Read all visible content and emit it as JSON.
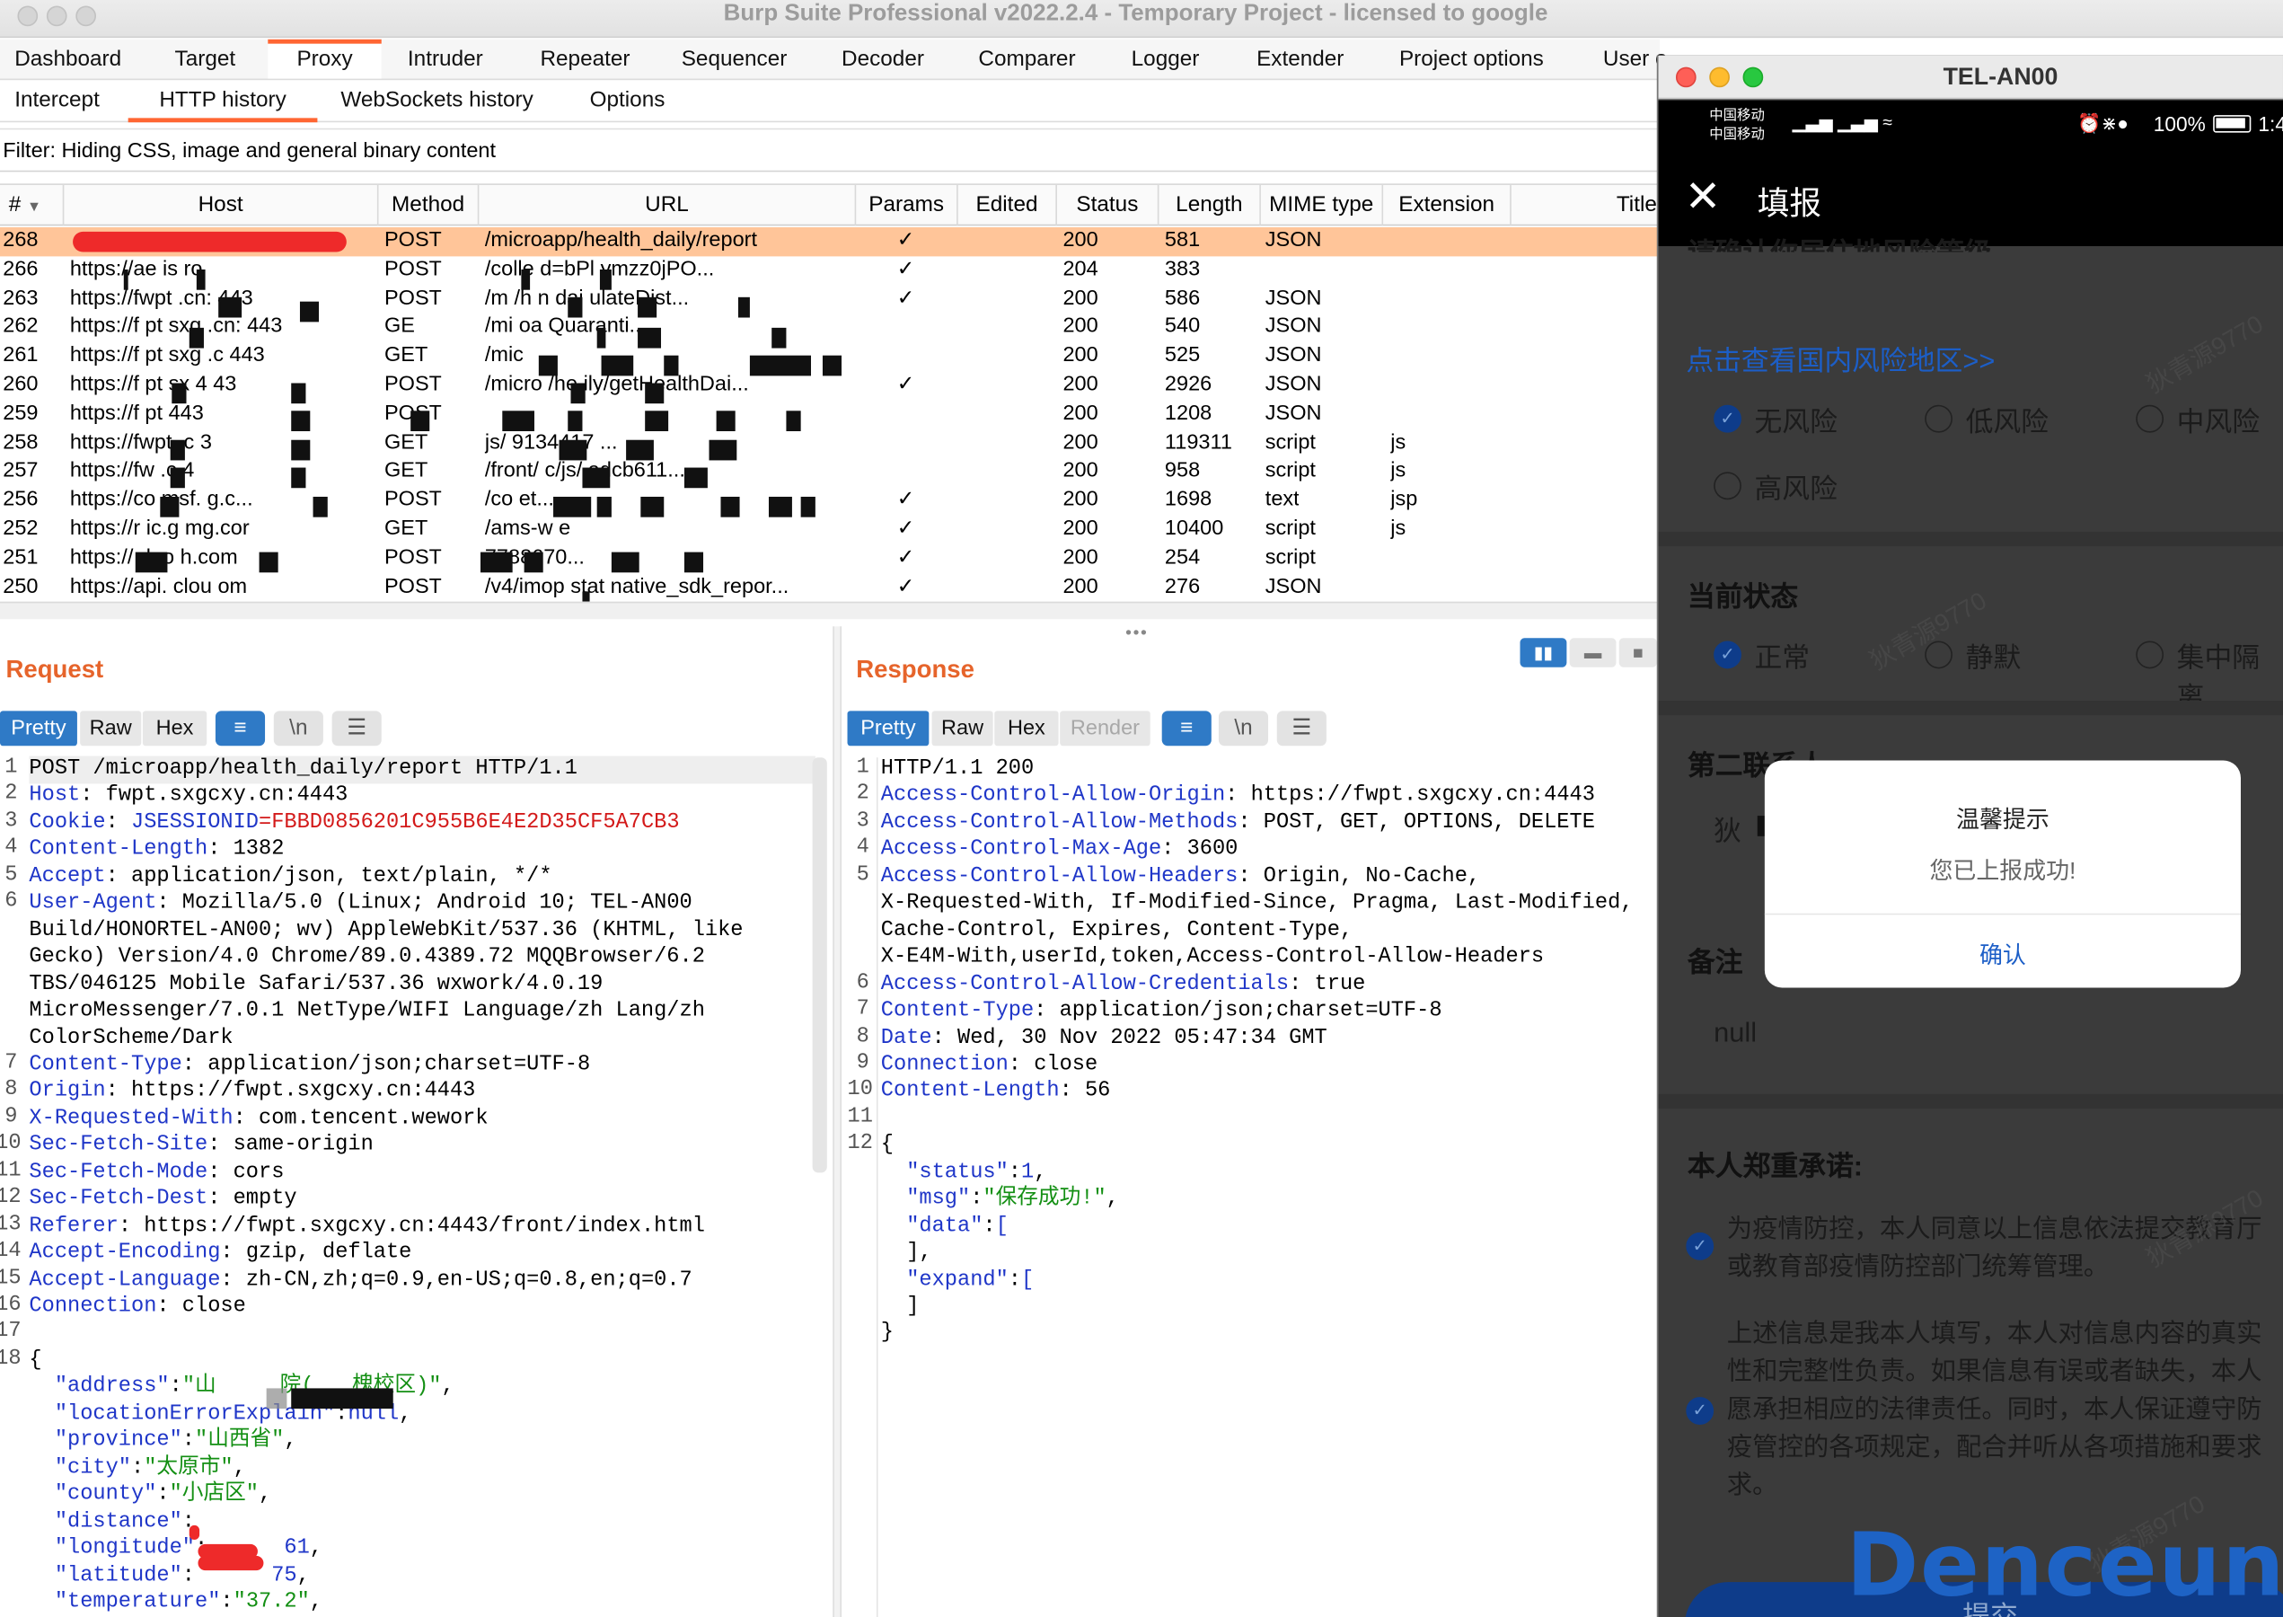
{
  "window": {
    "title": "Burp Suite Professional v2022.2.4 - Temporary Project - licensed to google"
  },
  "main_tabs": [
    "Dashboard",
    "Target",
    "Proxy",
    "Intruder",
    "Repeater",
    "Sequencer",
    "Decoder",
    "Comparer",
    "Logger",
    "Extender",
    "Project options",
    "User o"
  ],
  "proxy_tabs": [
    "Intercept",
    "HTTP history",
    "WebSockets history",
    "Options"
  ],
  "filter": "Filter: Hiding CSS, image and general binary content",
  "columns": [
    "#",
    "Host",
    "Method",
    "URL",
    "Params",
    "Edited",
    "Status",
    "Length",
    "MIME type",
    "Extension",
    "Title"
  ],
  "rows": [
    {
      "num": "268",
      "host": "",
      "method": "POST",
      "url": "/microapp/health_daily/report",
      "params": "✓",
      "status": "200",
      "length": "581",
      "mime": "JSON",
      "ext": ""
    },
    {
      "num": "266",
      "host": "https://ae  is  ro",
      "method": "POST",
      "url": "/colle     d=bPl           ymzz0jPO...",
      "params": "✓",
      "status": "204",
      "length": "383",
      "mime": "",
      "ext": ""
    },
    {
      "num": "263",
      "host": "https://fwpt        .cn:  443",
      "method": "POST",
      "url": "/m          /h     n dai    ulateDist...",
      "params": "✓",
      "status": "200",
      "length": "586",
      "mime": "JSON",
      "ext": ""
    },
    {
      "num": "262",
      "host": "https://f  pt  sxg    .cn:  443",
      "method": "GE",
      "url": "/mi  oa            Quaranti...",
      "params": "",
      "status": "200",
      "length": "540",
      "mime": "JSON",
      "ext": ""
    },
    {
      "num": "261",
      "host": "https://f  pt  sxg     .c   443",
      "method": "GET",
      "url": "/mic",
      "params": "",
      "status": "200",
      "length": "525",
      "mime": "JSON",
      "ext": ""
    },
    {
      "num": "260",
      "host": "https://f  pt  sx       4  43",
      "method": "POST",
      "url": "/micro     /he      ily/getHealthDai...",
      "params": "✓",
      "status": "200",
      "length": "2926",
      "mime": "JSON",
      "ext": ""
    },
    {
      "num": "259",
      "host": "https://f  pt       443",
      "method": "POST",
      "url": "",
      "params": "",
      "status": "200",
      "length": "1208",
      "mime": "JSON",
      "ext": ""
    },
    {
      "num": "258",
      "host": "https://fwpt    .c     3",
      "method": "GET",
      "url": "              js/            9134417 ...",
      "params": "",
      "status": "200",
      "length": "119311",
      "mime": "script",
      "ext": "js"
    },
    {
      "num": "257",
      "host": "https://fw       .c    4",
      "method": "GET",
      "url": "/front/   c/js/         adcb611...",
      "params": "",
      "status": "200",
      "length": "958",
      "mime": "script",
      "ext": "js"
    },
    {
      "num": "256",
      "host": "https://co     msf.   g.c...",
      "method": "POST",
      "url": "/co                          et...",
      "params": "✓",
      "status": "200",
      "length": "1698",
      "mime": "text",
      "ext": "jsp"
    },
    {
      "num": "252",
      "host": "https://r    ic.g    mg.cor",
      "method": "GET",
      "url": "/ams-w       e",
      "params": "✓",
      "status": "200",
      "length": "10400",
      "mime": "script",
      "ext": "js"
    },
    {
      "num": "251",
      "host": "https://      deo    h.com",
      "method": "POST",
      "url": "                        7788670...",
      "params": "✓",
      "status": "200",
      "length": "254",
      "mime": "script",
      "ext": ""
    },
    {
      "num": "250",
      "host": "https://api.      clou   om",
      "method": "POST",
      "url": "/v4/imop    stat   native_sdk_repor...",
      "params": "✓",
      "status": "200",
      "length": "276",
      "mime": "JSON",
      "ext": ""
    }
  ],
  "request": {
    "title": "Request",
    "buttons": [
      "Pretty",
      "Raw",
      "Hex"
    ],
    "icon_newline": "\\n",
    "lines": [
      {
        "n": "1",
        "t": "POST /microapp/health_daily/report HTTP/1.1"
      },
      {
        "n": "2",
        "k": "Host",
        "v": " fwpt.sxgcxy.cn:4443"
      },
      {
        "n": "3",
        "k": "Cookie",
        "v": " ",
        "ck": "JSESSIONID",
        "cv": "=FBBD0856201C955B6E4E2D35CF5A7CB3"
      },
      {
        "n": "4",
        "k": "Content-Length",
        "v": " 1382"
      },
      {
        "n": "5",
        "k": "Accept",
        "v": " application/json, text/plain, */*"
      },
      {
        "n": "6",
        "k": "User-Agent",
        "v": " Mozilla/5.0 (Linux; Android 10; TEL-AN00"
      },
      {
        "n": "",
        "t": "Build/HONORTEL-AN00; wv) AppleWebKit/537.36 (KHTML, like"
      },
      {
        "n": "",
        "t": "Gecko) Version/4.0 Chrome/89.0.4389.72 MQQBrowser/6.2"
      },
      {
        "n": "",
        "t": "TBS/046125 Mobile Safari/537.36 wxwork/4.0.19"
      },
      {
        "n": "",
        "t": "MicroMessenger/7.0.1 NetType/WIFI Language/zh Lang/zh"
      },
      {
        "n": "",
        "t": "ColorScheme/Dark"
      },
      {
        "n": "7",
        "k": "Content-Type",
        "v": " application/json;charset=UTF-8"
      },
      {
        "n": "8",
        "k": "Origin",
        "v": " https://fwpt.sxgcxy.cn:4443"
      },
      {
        "n": "9",
        "k": "X-Requested-With",
        "v": " com.tencent.wework"
      },
      {
        "n": "10",
        "k": "Sec-Fetch-Site",
        "v": " same-origin"
      },
      {
        "n": "11",
        "k": "Sec-Fetch-Mode",
        "v": " cors"
      },
      {
        "n": "12",
        "k": "Sec-Fetch-Dest",
        "v": " empty"
      },
      {
        "n": "13",
        "k": "Referer",
        "v": " https://fwpt.sxgcxy.cn:4443/front/index.html"
      },
      {
        "n": "14",
        "k": "Accept-Encoding",
        "v": " gzip, deflate"
      },
      {
        "n": "15",
        "k": "Accept-Language",
        "v": " zh-CN,zh;q=0.9,en-US;q=0.8,en;q=0.7"
      },
      {
        "n": "16",
        "k": "Connection",
        "v": " close"
      },
      {
        "n": "17",
        "t": ""
      },
      {
        "n": "18",
        "t": "{"
      },
      {
        "n": "",
        "jk": "  \"address\"",
        "jv": "\"山     院(   槐校区)\"",
        "tail": ","
      },
      {
        "n": "",
        "jk": "  \"locationErrorExplain\"",
        "jn": "null",
        "tail": ","
      },
      {
        "n": "",
        "jk": "  \"province\"",
        "jv": "\"山西省\"",
        "tail": ","
      },
      {
        "n": "",
        "jk": "  \"city\"",
        "jv": "\"太原市\"",
        "tail": ","
      },
      {
        "n": "",
        "jk": "  \"county\"",
        "jv": "\"小店区\"",
        "tail": ","
      },
      {
        "n": "",
        "jk": "  \"distance\"",
        "jn": "",
        "tail": ""
      },
      {
        "n": "",
        "jk": "  \"longitude\"",
        "jn": "      61",
        "tail": ","
      },
      {
        "n": "",
        "jk": "  \"latitude\"",
        "jn": "      75",
        "tail": ","
      },
      {
        "n": "",
        "jk": "  \"temperature\"",
        "jv": "\"37.2\"",
        "tail": ","
      }
    ]
  },
  "response": {
    "title": "Response",
    "buttons": [
      "Pretty",
      "Raw",
      "Hex",
      "Render"
    ],
    "icon_newline": "\\n",
    "lines": [
      {
        "n": "1",
        "t": "HTTP/1.1 200"
      },
      {
        "n": "2",
        "k": "Access-Control-Allow-Origin",
        "v": " https://fwpt.sxgcxy.cn:4443"
      },
      {
        "n": "3",
        "k": "Access-Control-Allow-Methods",
        "v": " POST, GET, OPTIONS, DELETE"
      },
      {
        "n": "4",
        "k": "Access-Control-Max-Age",
        "v": " 3600"
      },
      {
        "n": "5",
        "k": "Access-Control-Allow-Headers",
        "v": " Origin, No-Cache,"
      },
      {
        "n": "",
        "t": "X-Requested-With, If-Modified-Since, Pragma, Last-Modified,"
      },
      {
        "n": "",
        "t": "Cache-Control, Expires, Content-Type,"
      },
      {
        "n": "",
        "t": "X-E4M-With,userId,token,Access-Control-Allow-Headers"
      },
      {
        "n": "6",
        "k": "Access-Control-Allow-Credentials",
        "v": " true"
      },
      {
        "n": "7",
        "k": "Content-Type",
        "v": " application/json;charset=UTF-8"
      },
      {
        "n": "8",
        "k": "Date",
        "v": " Wed, 30 Nov 2022 05:47:34 GMT"
      },
      {
        "n": "9",
        "k": "Connection",
        "v": " close"
      },
      {
        "n": "10",
        "k": "Content-Length",
        "v": " 56"
      },
      {
        "n": "11",
        "t": ""
      },
      {
        "n": "12",
        "t": "{"
      },
      {
        "n": "",
        "jk": "  \"status\"",
        "jn": "1",
        "tail": ","
      },
      {
        "n": "",
        "jk": "  \"msg\"",
        "jv": "\"保存成功!\"",
        "tail": ","
      },
      {
        "n": "",
        "jk": "  \"data\"",
        "jn": "[",
        "tail": ""
      },
      {
        "n": "",
        "t": "  ],"
      },
      {
        "n": "",
        "jk": "  \"expand\"",
        "jn": "[",
        "tail": ""
      },
      {
        "n": "",
        "t": "  ]"
      },
      {
        "n": "",
        "t": "}"
      }
    ]
  },
  "phone": {
    "window_title": "TEL-AN00",
    "status_left_1": "中国移动",
    "status_left_2": "中国移动",
    "status_right": "100%",
    "status_time": "1:4",
    "app_title": "填报",
    "cut_top_text": "请确认你居住地风险等级",
    "risk_link": "点击查看国内风险地区>>",
    "risk_options": [
      "无风险",
      "低风险",
      "中风险",
      "高风险"
    ],
    "status_section": "当前状态",
    "status_options": [
      "正常",
      "静默",
      "集中隔离"
    ],
    "contact_section": "第二联系人",
    "contact_value": "狄",
    "remark_section": "备注",
    "remark_value": "null",
    "promise_section": "本人郑重承诺:",
    "promise_1": [
      "为疫情防控，本人同意以上信息依法提交教育厅",
      "或教育部疫情防控部门统筹管理。"
    ],
    "promise_2": [
      "上述信息是我本人填写，本人对信息内容的真实",
      "性和完整性负责。如果信息有误或者缺失，本人",
      "愿承担相应的法律责任。同时，本人保证遵守防",
      "疫管控的各项规定，配合并听从各项措施和要求",
      "求。"
    ],
    "submit": "提交",
    "watermark_text": "狄青源9770",
    "dialog": {
      "title": "温馨提示",
      "message": "您已上报成功!",
      "confirm": "确认"
    }
  },
  "overlay_watermark": "Denceun"
}
